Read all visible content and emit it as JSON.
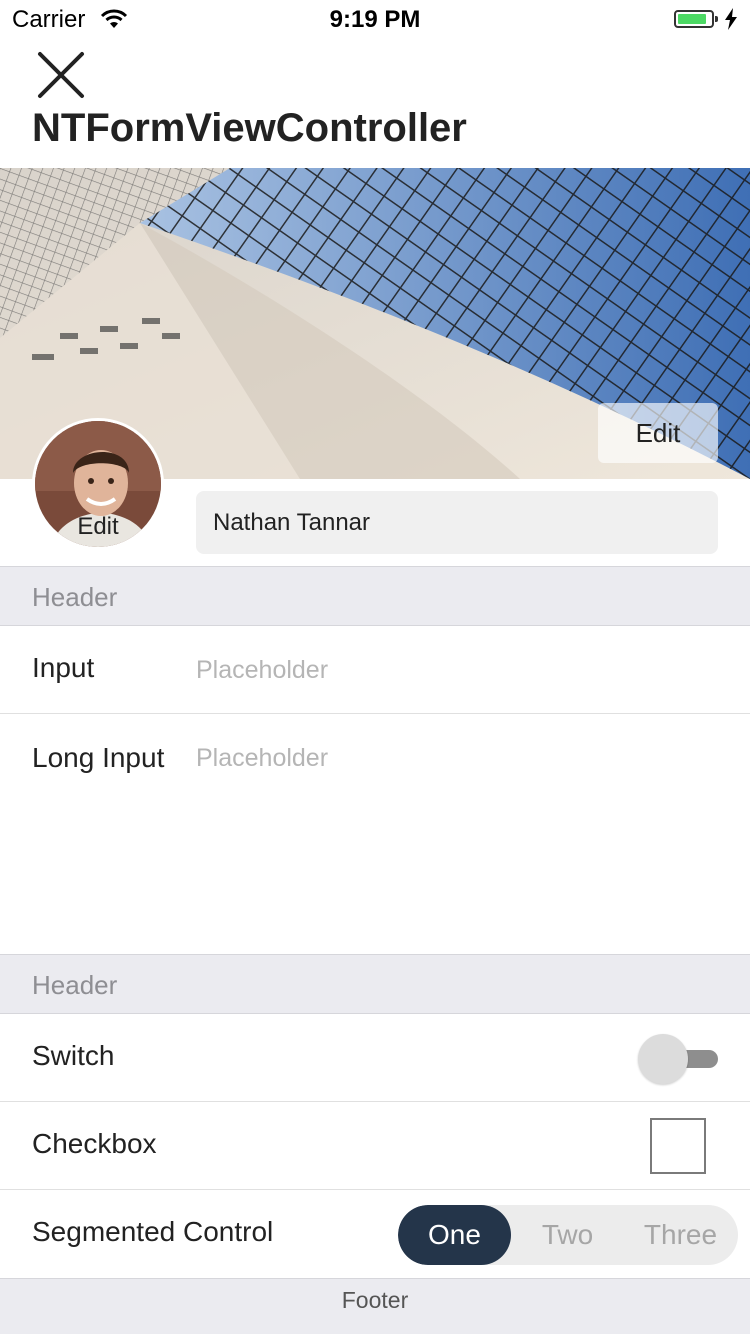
{
  "status_bar": {
    "carrier": "Carrier",
    "time": "9:19 PM",
    "battery_level": 0.8
  },
  "nav": {
    "title": "NTFormViewController",
    "close_icon": "close-icon"
  },
  "banner": {
    "edit_label": "Edit",
    "image": "glass-dome-ceiling-photo"
  },
  "profile": {
    "avatar_edit_label": "Edit",
    "name_value": "Nathan Tannar"
  },
  "sections": [
    {
      "header": "Header",
      "rows": [
        {
          "label": "Input",
          "placeholder": "Placeholder"
        },
        {
          "label": "Long Input",
          "placeholder": "Placeholder"
        }
      ]
    },
    {
      "header": "Header",
      "rows": [
        {
          "label": "Switch",
          "value": false
        },
        {
          "label": "Checkbox",
          "value": false
        },
        {
          "label": "Segmented Control",
          "options": [
            "One",
            "Two",
            "Three"
          ],
          "selected": "One"
        }
      ]
    }
  ],
  "footer": "Footer",
  "colors": {
    "segment_active": "#24354a",
    "header_bg": "#ebebf0",
    "battery": "#4cd964"
  }
}
